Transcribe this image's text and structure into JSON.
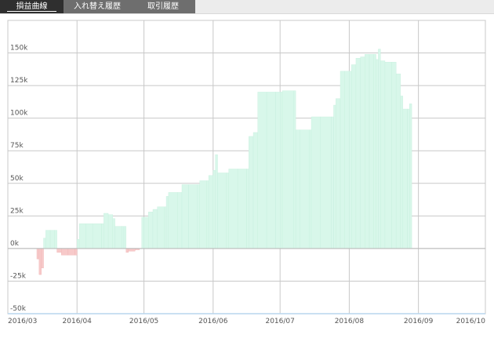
{
  "tabs": [
    {
      "label": "損益曲線",
      "active": true
    },
    {
      "label": "入れ替え履歴",
      "active": false
    },
    {
      "label": "取引履歴",
      "active": false
    }
  ],
  "colors": {
    "positive_fill": "#d8f7ea",
    "positive_stroke": "#c6efdd",
    "negative_fill": "#f7c9c9",
    "negative_stroke": "#f1b4b4",
    "grid": "#c8c8c8",
    "axis_text": "#555555"
  },
  "chart_data": {
    "type": "area",
    "title": "",
    "xlabel": "",
    "ylabel": "",
    "x_ticks": [
      "2016/03",
      "2016/04",
      "2016/05",
      "2016/06",
      "2016/07",
      "2016/08",
      "2016/09",
      "2016/10"
    ],
    "y_ticks": [
      {
        "value": 150000,
        "label": "150k"
      },
      {
        "value": 125000,
        "label": "125k"
      },
      {
        "value": 100000,
        "label": "100k"
      },
      {
        "value": 75000,
        "label": "75k"
      },
      {
        "value": 50000,
        "label": "50k"
      },
      {
        "value": 25000,
        "label": "25k"
      },
      {
        "value": 0,
        "label": "0k"
      },
      {
        "value": -25000,
        "label": "-25k"
      },
      {
        "value": -50000,
        "label": "-50k"
      }
    ],
    "xlim": [
      "2016-03-01",
      "2016-10-01"
    ],
    "ylim": [
      -50000,
      175000
    ],
    "grid": true,
    "series": [
      {
        "values": [
          [
            "2016-03-13",
            0
          ],
          [
            "2016-03-14",
            -8000
          ],
          [
            "2016-03-15",
            -20000
          ],
          [
            "2016-03-16",
            -15000
          ],
          [
            "2016-03-17",
            8000
          ],
          [
            "2016-03-18",
            14000
          ],
          [
            "2016-03-20",
            14000
          ],
          [
            "2016-03-22",
            14000
          ],
          [
            "2016-03-23",
            -3000
          ],
          [
            "2016-03-25",
            -5000
          ],
          [
            "2016-03-28",
            -5000
          ],
          [
            "2016-03-31",
            -5000
          ],
          [
            "2016-04-01",
            7000
          ],
          [
            "2016-04-02",
            19000
          ],
          [
            "2016-04-05",
            19000
          ],
          [
            "2016-04-08",
            19000
          ],
          [
            "2016-04-12",
            19000
          ],
          [
            "2016-04-13",
            27000
          ],
          [
            "2016-04-15",
            26000
          ],
          [
            "2016-04-17",
            23000
          ],
          [
            "2016-04-18",
            17000
          ],
          [
            "2016-04-21",
            17000
          ],
          [
            "2016-04-22",
            17000
          ],
          [
            "2016-04-23",
            -3000
          ],
          [
            "2016-04-24",
            -2000
          ],
          [
            "2016-04-27",
            -1000
          ],
          [
            "2016-04-29",
            0
          ],
          [
            "2016-04-30",
            24000
          ],
          [
            "2016-05-01",
            24000
          ],
          [
            "2016-05-03",
            28000
          ],
          [
            "2016-05-05",
            30000
          ],
          [
            "2016-05-07",
            32000
          ],
          [
            "2016-05-10",
            32000
          ],
          [
            "2016-05-11",
            40000
          ],
          [
            "2016-05-12",
            43000
          ],
          [
            "2016-05-16",
            43000
          ],
          [
            "2016-05-18",
            49000
          ],
          [
            "2016-05-21",
            49000
          ],
          [
            "2016-05-25",
            49000
          ],
          [
            "2016-05-26",
            52000
          ],
          [
            "2016-05-29",
            52000
          ],
          [
            "2016-05-30",
            56000
          ],
          [
            "2016-06-01",
            60000
          ],
          [
            "2016-06-02",
            72000
          ],
          [
            "2016-06-03",
            58000
          ],
          [
            "2016-06-07",
            58000
          ],
          [
            "2016-06-08",
            61000
          ],
          [
            "2016-06-12",
            61000
          ],
          [
            "2016-06-16",
            61000
          ],
          [
            "2016-06-17",
            86000
          ],
          [
            "2016-06-19",
            89000
          ],
          [
            "2016-06-21",
            120000
          ],
          [
            "2016-06-25",
            120000
          ],
          [
            "2016-06-29",
            120000
          ],
          [
            "2016-07-01",
            120000
          ],
          [
            "2016-07-02",
            121000
          ],
          [
            "2016-07-07",
            121000
          ],
          [
            "2016-07-08",
            91000
          ],
          [
            "2016-07-10",
            91000
          ],
          [
            "2016-07-14",
            91000
          ],
          [
            "2016-07-15",
            101000
          ],
          [
            "2016-07-19",
            101000
          ],
          [
            "2016-07-24",
            101000
          ],
          [
            "2016-07-25",
            110000
          ],
          [
            "2016-07-26",
            115000
          ],
          [
            "2016-07-28",
            136000
          ],
          [
            "2016-07-30",
            136000
          ],
          [
            "2016-08-01",
            136000
          ],
          [
            "2016-08-02",
            141000
          ],
          [
            "2016-08-04",
            146000
          ],
          [
            "2016-08-06",
            147000
          ],
          [
            "2016-08-08",
            149000
          ],
          [
            "2016-08-10",
            149000
          ],
          [
            "2016-08-12",
            149000
          ],
          [
            "2016-08-13",
            145000
          ],
          [
            "2016-08-14",
            153000
          ],
          [
            "2016-08-15",
            144000
          ],
          [
            "2016-08-17",
            143000
          ],
          [
            "2016-08-20",
            143000
          ],
          [
            "2016-08-22",
            134000
          ],
          [
            "2016-08-24",
            117000
          ],
          [
            "2016-08-25",
            107000
          ],
          [
            "2016-08-27",
            107000
          ],
          [
            "2016-08-28",
            111000
          ],
          [
            "2016-08-29",
            0
          ]
        ]
      }
    ]
  }
}
